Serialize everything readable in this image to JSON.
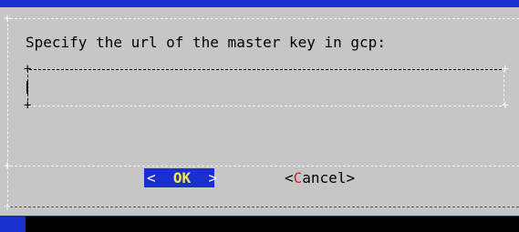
{
  "dialog": {
    "prompt": "Specify the url of the master key in gcp:",
    "input_value": ""
  },
  "buttons": {
    "ok_label": "OK",
    "cancel_hotkey": "C",
    "cancel_rest": "ancel"
  },
  "colors": {
    "background": "#1a2fd0",
    "dialog": "#c6c6c6",
    "ok_highlight": "#1a2fd0",
    "ok_text": "#f5e74c",
    "hotkey": "#c62828"
  }
}
